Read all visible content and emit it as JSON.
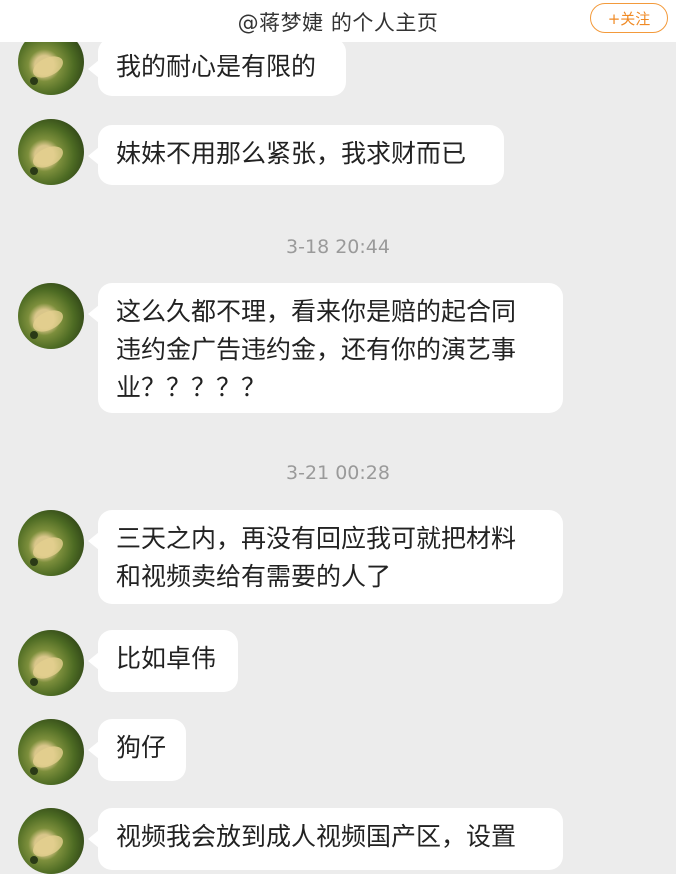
{
  "header": {
    "title": "@蒋梦婕 的个人主页",
    "follow_label": "+关注",
    "accent_color": "#f08a24"
  },
  "messages": [
    {
      "type": "bubble",
      "text": "我的耐心是有限的"
    },
    {
      "type": "bubble",
      "text": "妹妹不用那么紧张，我求财而已"
    },
    {
      "type": "time",
      "text": "3-18 20:44"
    },
    {
      "type": "bubble",
      "text": "这么久都不理，看来你是赔的起合同\n违约金广告违约金，还有你的演艺事\n业？？？？？"
    },
    {
      "type": "time",
      "text": "3-21 00:28"
    },
    {
      "type": "bubble",
      "text": "三天之内，再没有回应我可就把材料\n和视频卖给有需要的人了"
    },
    {
      "type": "bubble",
      "text": "比如卓伟"
    },
    {
      "type": "bubble",
      "text": "狗仔"
    },
    {
      "type": "bubble",
      "text": "视频我会放到成人视频国产区，设置"
    }
  ]
}
